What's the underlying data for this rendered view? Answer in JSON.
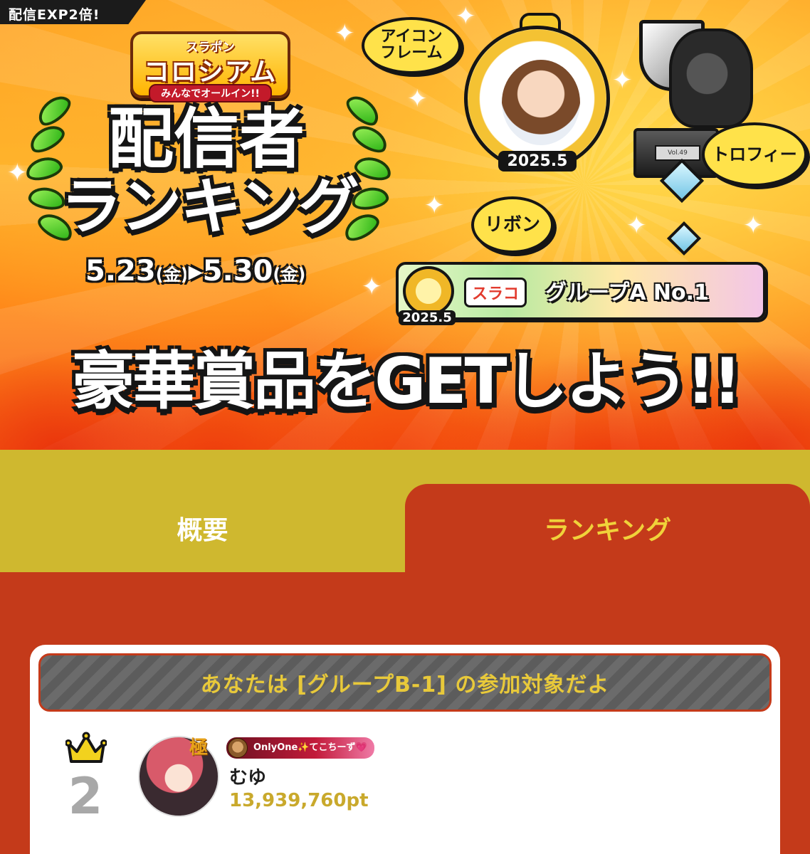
{
  "banner": {
    "exp_tab": "配信EXP2倍!",
    "logo": {
      "top": "スラポン",
      "main": "コロシアム",
      "sub": "みんなでオールイン!!"
    },
    "title_line1": "配信者",
    "title_line2": "ランキング",
    "dates": {
      "start": "5.23",
      "start_day": "(金)",
      "arrow": "▸",
      "end": "5.30",
      "end_day": "(金)"
    },
    "bubbles": {
      "icon_frame": "アイコン\nフレーム",
      "trophy": "トロフィー",
      "ribbon": "リボン"
    },
    "frame_label": "2025.5",
    "frame_suraco": "スラコ",
    "trophy_plate": "Vol.49",
    "ribbon": {
      "suraco": "スラコ",
      "group": "グループA No.1",
      "date": "2025.5"
    },
    "headline": "豪華賞品をGETしよう!!"
  },
  "tabs": {
    "overview": "概要",
    "ranking": "ランキング"
  },
  "ranking_card": {
    "group_notice": "あなたは [グループB-1] の参加対象だよ",
    "entry": {
      "rank": "2",
      "avatar_badge": "極",
      "badge_strip": "OnlyOne✨てこちーず💗",
      "name": "むゆ",
      "points": "13,939,760pt"
    }
  },
  "colors": {
    "tab_bar": "#cfb82f",
    "active_tab": "#c43a1a",
    "points": "#c9a92c",
    "rank_gray": "#a8a8a8",
    "crown": "#f2d21e"
  },
  "icons": [
    "crown-icon",
    "sparkle-icon",
    "laurel-icon",
    "trophy-icon"
  ]
}
